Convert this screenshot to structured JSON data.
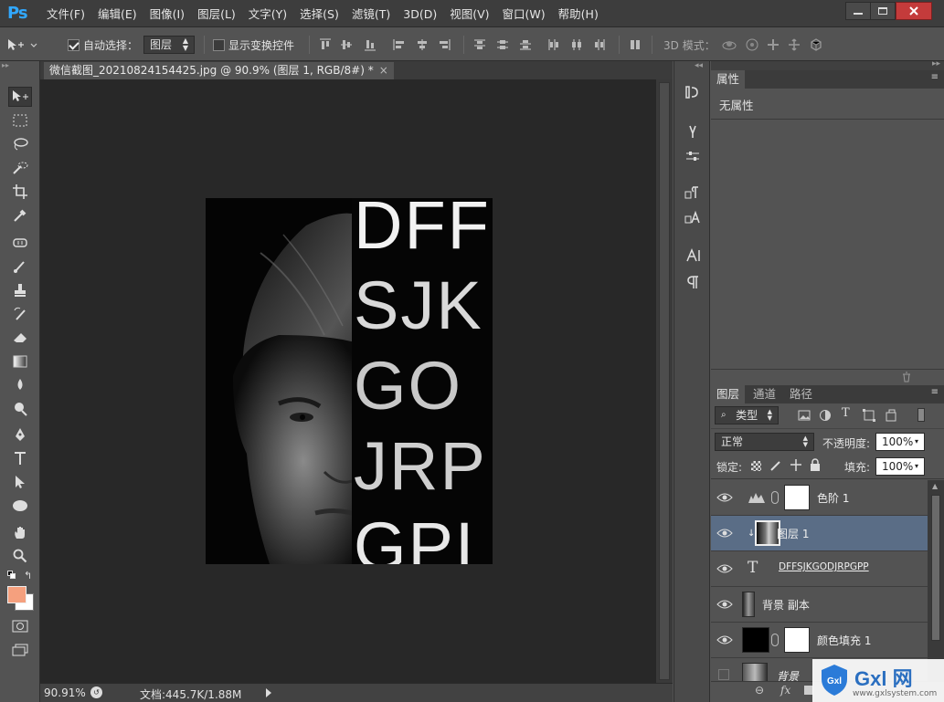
{
  "app": {
    "logo": "Ps"
  },
  "menu": [
    "文件(F)",
    "编辑(E)",
    "图像(I)",
    "图层(L)",
    "文字(Y)",
    "选择(S)",
    "滤镜(T)",
    "3D(D)",
    "视图(V)",
    "窗口(W)",
    "帮助(H)"
  ],
  "options": {
    "auto_select_label": "自动选择：",
    "auto_select_checked": true,
    "auto_select_target": "图层",
    "show_transform_label": "显示变换控件",
    "show_transform_checked": false,
    "mode3d_label": "3D 模式："
  },
  "document": {
    "tab_title": "微信截图_20210824154425.jpg @ 90.9% (图层 1, RGB/8#) *",
    "close_glyph": "×",
    "art_lines": [
      "DFF",
      "SJK",
      "GO",
      "JRP",
      "GPI"
    ]
  },
  "status": {
    "zoom": "90.91%",
    "doc_info": "文档:445.7K/1.88M"
  },
  "properties": {
    "tab_label": "属性",
    "content": "无属性"
  },
  "layers_panel": {
    "tabs": [
      "图层",
      "通道",
      "路径"
    ],
    "filter_kind": "类型",
    "blend_mode": "正常",
    "opacity_label": "不透明度:",
    "opacity_value": "100%",
    "lock_label": "锁定:",
    "fill_label": "填充:",
    "fill_value": "100%",
    "layers": [
      {
        "name": "色阶 1",
        "visible": true,
        "selected": false,
        "kind": "adjustment"
      },
      {
        "name": "图层 1",
        "visible": true,
        "selected": true,
        "kind": "image-clipped"
      },
      {
        "name": "DFFSJKGODJRPGPP",
        "visible": true,
        "selected": false,
        "kind": "text"
      },
      {
        "name": "背景 副本",
        "visible": true,
        "selected": false,
        "kind": "image"
      },
      {
        "name": "颜色填充 1",
        "visible": true,
        "selected": false,
        "kind": "fill"
      },
      {
        "name": "背景",
        "visible": false,
        "selected": false,
        "kind": "image"
      }
    ]
  },
  "watermark": {
    "brand": "Gxl 网",
    "url": "www.gxlsystem.com"
  },
  "colors": {
    "foreground": "#f5a07e",
    "background": "#ffffff",
    "selected_layer": "#5a6d86",
    "canvas_bg": "#282828"
  }
}
